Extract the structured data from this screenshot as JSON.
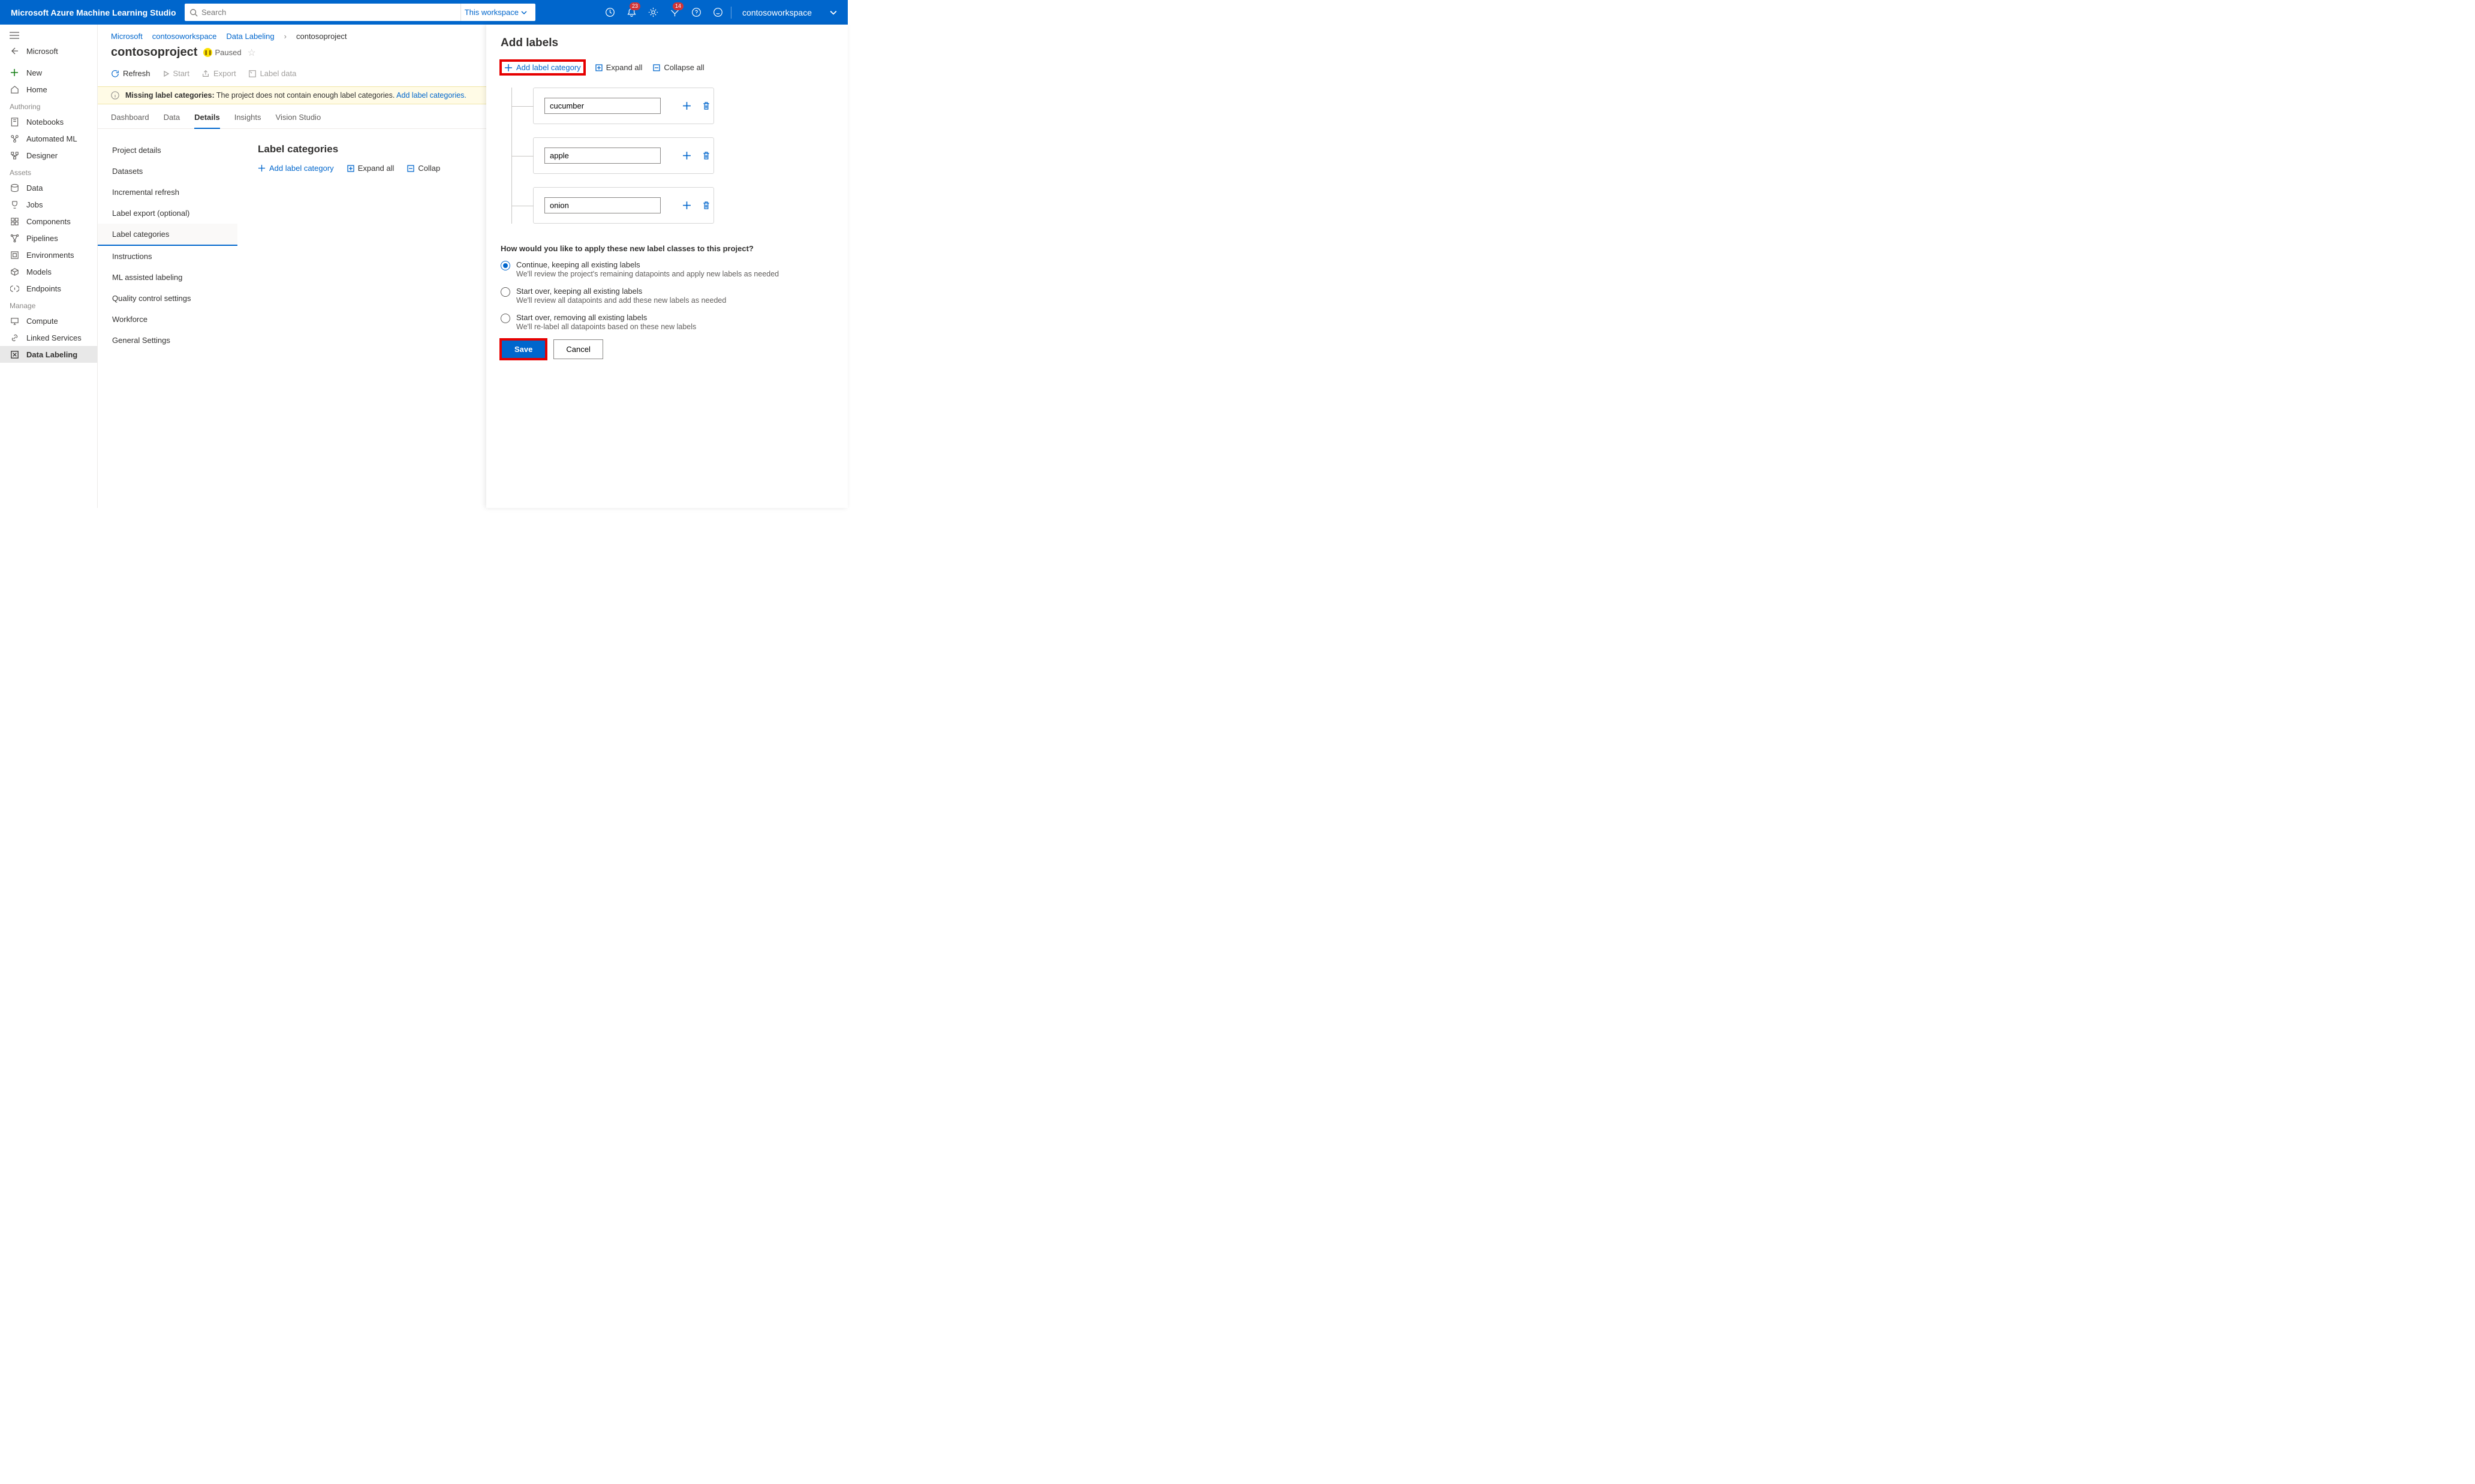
{
  "topbar": {
    "brand": "Microsoft Azure Machine Learning Studio",
    "search_placeholder": "Search",
    "scope_label": "This workspace",
    "workspace": "contosoworkspace",
    "badges": {
      "notifications": "23",
      "feedback": "14"
    }
  },
  "sidebar": {
    "back_label": "Microsoft",
    "items": [
      {
        "label": "New",
        "icon": "plus"
      },
      {
        "label": "Home",
        "icon": "home"
      }
    ],
    "authoring_label": "Authoring",
    "authoring": [
      {
        "label": "Notebooks",
        "icon": "notebook"
      },
      {
        "label": "Automated ML",
        "icon": "auto"
      },
      {
        "label": "Designer",
        "icon": "designer"
      }
    ],
    "assets_label": "Assets",
    "assets": [
      {
        "label": "Data",
        "icon": "data"
      },
      {
        "label": "Jobs",
        "icon": "jobs"
      },
      {
        "label": "Components",
        "icon": "components"
      },
      {
        "label": "Pipelines",
        "icon": "pipelines"
      },
      {
        "label": "Environments",
        "icon": "env"
      },
      {
        "label": "Models",
        "icon": "models"
      },
      {
        "label": "Endpoints",
        "icon": "endpoints"
      }
    ],
    "manage_label": "Manage",
    "manage": [
      {
        "label": "Compute",
        "icon": "compute"
      },
      {
        "label": "Linked Services",
        "icon": "link"
      },
      {
        "label": "Data Labeling",
        "icon": "label",
        "active": true
      }
    ]
  },
  "breadcrumb": [
    "Microsoft",
    "contosoworkspace",
    "Data Labeling",
    "contosoproject"
  ],
  "project": {
    "title": "contosoproject",
    "status": "Paused"
  },
  "toolbar": {
    "refresh": "Refresh",
    "start": "Start",
    "export": "Export",
    "label_data": "Label data"
  },
  "banner": {
    "title": "Missing label categories:",
    "msg": "The project does not contain enough label categories.",
    "link": "Add label categories."
  },
  "tabs": [
    "Dashboard",
    "Data",
    "Details",
    "Insights",
    "Vision Studio"
  ],
  "active_tab": "Details",
  "subnav": [
    "Project details",
    "Datasets",
    "Incremental refresh",
    "Label export (optional)",
    "Label categories",
    "Instructions",
    "ML assisted labeling",
    "Quality control settings",
    "Workforce",
    "General Settings"
  ],
  "active_sub": "Label categories",
  "panel": {
    "heading": "Label categories",
    "add": "Add label category",
    "expand": "Expand all",
    "collapse": "Collap"
  },
  "flyout": {
    "title": "Add labels",
    "add": "Add label category",
    "expand": "Expand all",
    "collapse": "Collapse all",
    "labels": [
      {
        "name": "cucumber",
        "color": "#3a0a4a"
      },
      {
        "name": "apple",
        "color": "#e3008c"
      },
      {
        "name": "onion",
        "color": "#0b2e7a"
      }
    ],
    "question": "How would you like to apply these new label classes to this project?",
    "options": [
      {
        "t1": "Continue, keeping all existing labels",
        "t2": "We'll review the project's remaining datapoints and apply new labels as needed",
        "selected": true
      },
      {
        "t1": "Start over, keeping all existing labels",
        "t2": "We'll review all datapoints and add these new labels as needed"
      },
      {
        "t1": "Start over, removing all existing labels",
        "t2": "We'll re-label all datapoints based on these new labels"
      }
    ],
    "save": "Save",
    "cancel": "Cancel"
  }
}
